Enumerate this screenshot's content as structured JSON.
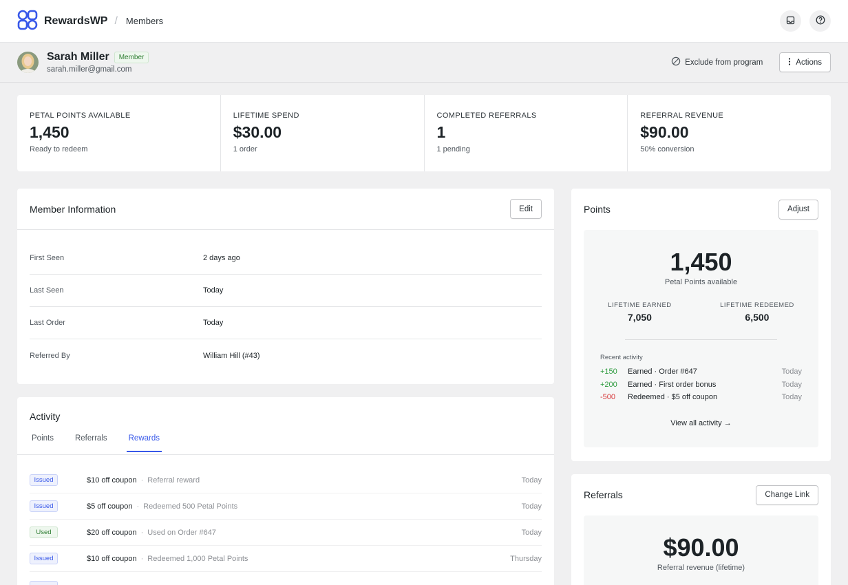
{
  "header": {
    "brand": "RewardsWP",
    "separator": "/",
    "breadcrumb": "Members"
  },
  "member": {
    "name": "Sarah Miller",
    "badge": "Member",
    "email": "sarah.miller@gmail.com",
    "exclude_label": "Exclude from program",
    "actions_label": "Actions"
  },
  "stats": [
    {
      "label": "PETAL POINTS AVAILABLE",
      "value": "1,450",
      "sub": "Ready to redeem"
    },
    {
      "label": "LIFETIME SPEND",
      "value": "$30.00",
      "sub": "1 order"
    },
    {
      "label": "COMPLETED REFERRALS",
      "value": "1",
      "sub": "1 pending"
    },
    {
      "label": "REFERRAL REVENUE",
      "value": "$90.00",
      "sub": "50% conversion"
    }
  ],
  "member_info": {
    "title": "Member Information",
    "edit_label": "Edit",
    "rows": [
      {
        "key": "First Seen",
        "value": "2 days ago"
      },
      {
        "key": "Last Seen",
        "value": "Today"
      },
      {
        "key": "Last Order",
        "value": "Today"
      },
      {
        "key": "Referred By",
        "value": "William Hill (#43)"
      }
    ]
  },
  "activity": {
    "title": "Activity",
    "tabs": [
      "Points",
      "Referrals",
      "Rewards"
    ],
    "active_tab": "Rewards",
    "rewards": [
      {
        "status": "Issued",
        "title": "$10 off coupon",
        "desc": "Referral reward",
        "date": "Today"
      },
      {
        "status": "Issued",
        "title": "$5 off coupon",
        "desc": "Redeemed 500 Petal Points",
        "date": "Today"
      },
      {
        "status": "Used",
        "title": "$20 off coupon",
        "desc": "Used on Order #647",
        "date": "Today"
      },
      {
        "status": "Issued",
        "title": "$10 off coupon",
        "desc": "Redeemed 1,000 Petal Points",
        "date": "Thursday"
      }
    ]
  },
  "points": {
    "title": "Points",
    "adjust_label": "Adjust",
    "total": "1,450",
    "total_sub": "Petal Points available",
    "lifetime_earned_label": "LIFETIME EARNED",
    "lifetime_earned": "7,050",
    "lifetime_redeemed_label": "LIFETIME REDEEMED",
    "lifetime_redeemed": "6,500",
    "recent_label": "Recent activity",
    "recent": [
      {
        "delta": "+150",
        "desc": "Earned · Order #647",
        "date": "Today",
        "kind": "pos"
      },
      {
        "delta": "+200",
        "desc": "Earned · First order bonus",
        "date": "Today",
        "kind": "pos"
      },
      {
        "delta": "-500",
        "desc": "Redeemed · $5 off coupon",
        "date": "Today",
        "kind": "neg"
      }
    ],
    "view_all": "View all activity →"
  },
  "referrals": {
    "title": "Referrals",
    "change_link_label": "Change Link",
    "revenue": "$90.00",
    "revenue_sub": "Referral revenue (lifetime)"
  },
  "colors": {
    "accent": "#3858e9",
    "positive": "#2e9b3f",
    "negative": "#d63638"
  }
}
